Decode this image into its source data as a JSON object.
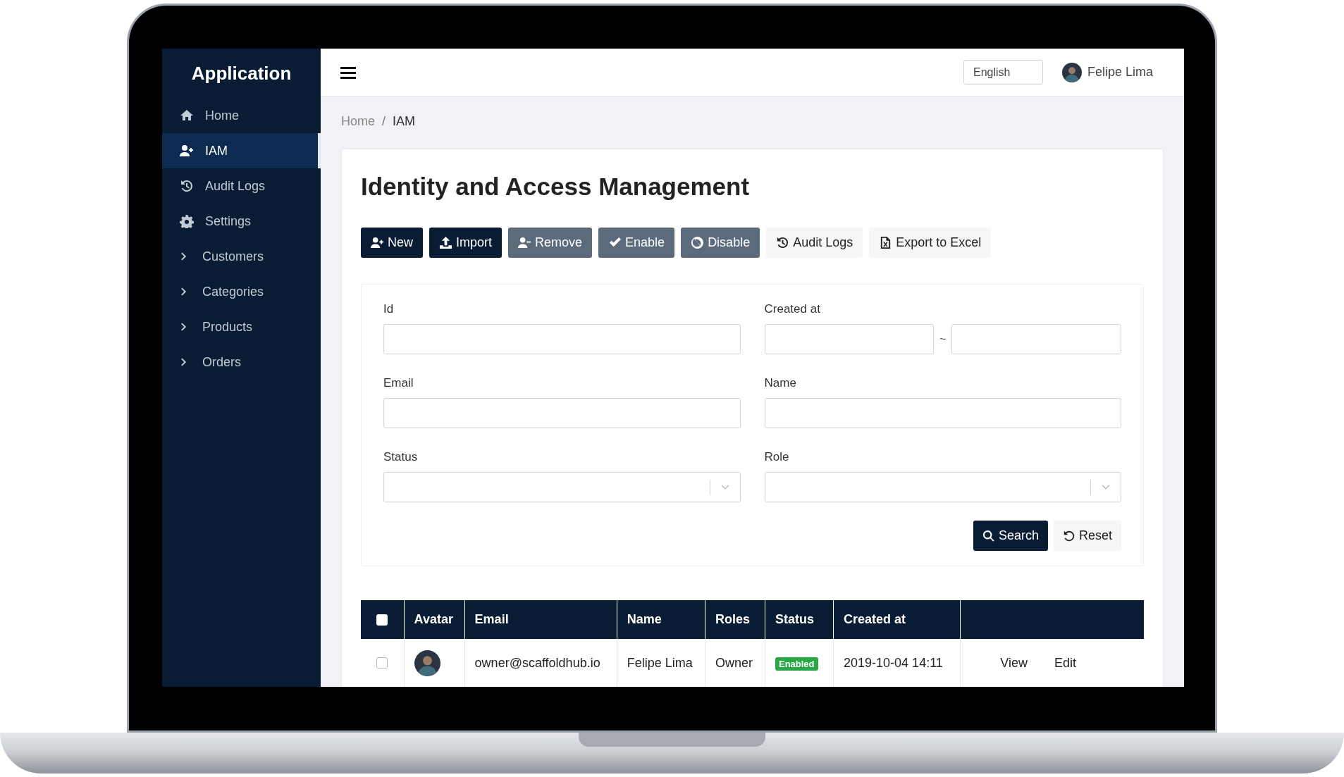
{
  "sidebar": {
    "title": "Application",
    "items": [
      {
        "label": "Home",
        "kind": "link",
        "selected": false
      },
      {
        "label": "IAM",
        "kind": "link",
        "selected": true
      },
      {
        "label": "Audit Logs",
        "kind": "link",
        "selected": false
      },
      {
        "label": "Settings",
        "kind": "link",
        "selected": false
      },
      {
        "label": "Customers",
        "kind": "group",
        "selected": false
      },
      {
        "label": "Categories",
        "kind": "group",
        "selected": false
      },
      {
        "label": "Products",
        "kind": "group",
        "selected": false
      },
      {
        "label": "Orders",
        "kind": "group",
        "selected": false
      }
    ]
  },
  "header": {
    "language": "English",
    "user": "Felipe Lima"
  },
  "breadcrumb": {
    "items": [
      "Home",
      "IAM"
    ],
    "separator": "/"
  },
  "page_title": "Identity and Access Management",
  "toolbar": [
    {
      "label": "New"
    },
    {
      "label": "Import"
    },
    {
      "label": "Remove"
    },
    {
      "label": "Enable"
    },
    {
      "label": "Disable"
    },
    {
      "label": "Audit Logs"
    },
    {
      "label": "Export to Excel"
    }
  ],
  "filters": [
    {
      "label": "Id",
      "kind": "text"
    },
    {
      "label": "Created at",
      "kind": "daterange",
      "separator": "~"
    },
    {
      "label": "Email",
      "kind": "text"
    },
    {
      "label": "Name",
      "kind": "text"
    },
    {
      "label": "Status",
      "kind": "select"
    },
    {
      "label": "Role",
      "kind": "select"
    }
  ],
  "filter_buttons": [
    {
      "label": "Search"
    },
    {
      "label": "Reset"
    }
  ],
  "table": {
    "select_all": {
      "checked": false
    },
    "columns": [
      "Avatar",
      "Email",
      "Name",
      "Roles",
      "Status",
      "Created at"
    ],
    "rows": [
      {
        "selected": false,
        "email": "owner@scaffoldhub.io",
        "name": "Felipe Lima",
        "roles": "Owner",
        "status": "Enabled",
        "created_at": "2019-10-04 14:11",
        "actions": [
          "View",
          "Edit"
        ]
      }
    ]
  }
}
